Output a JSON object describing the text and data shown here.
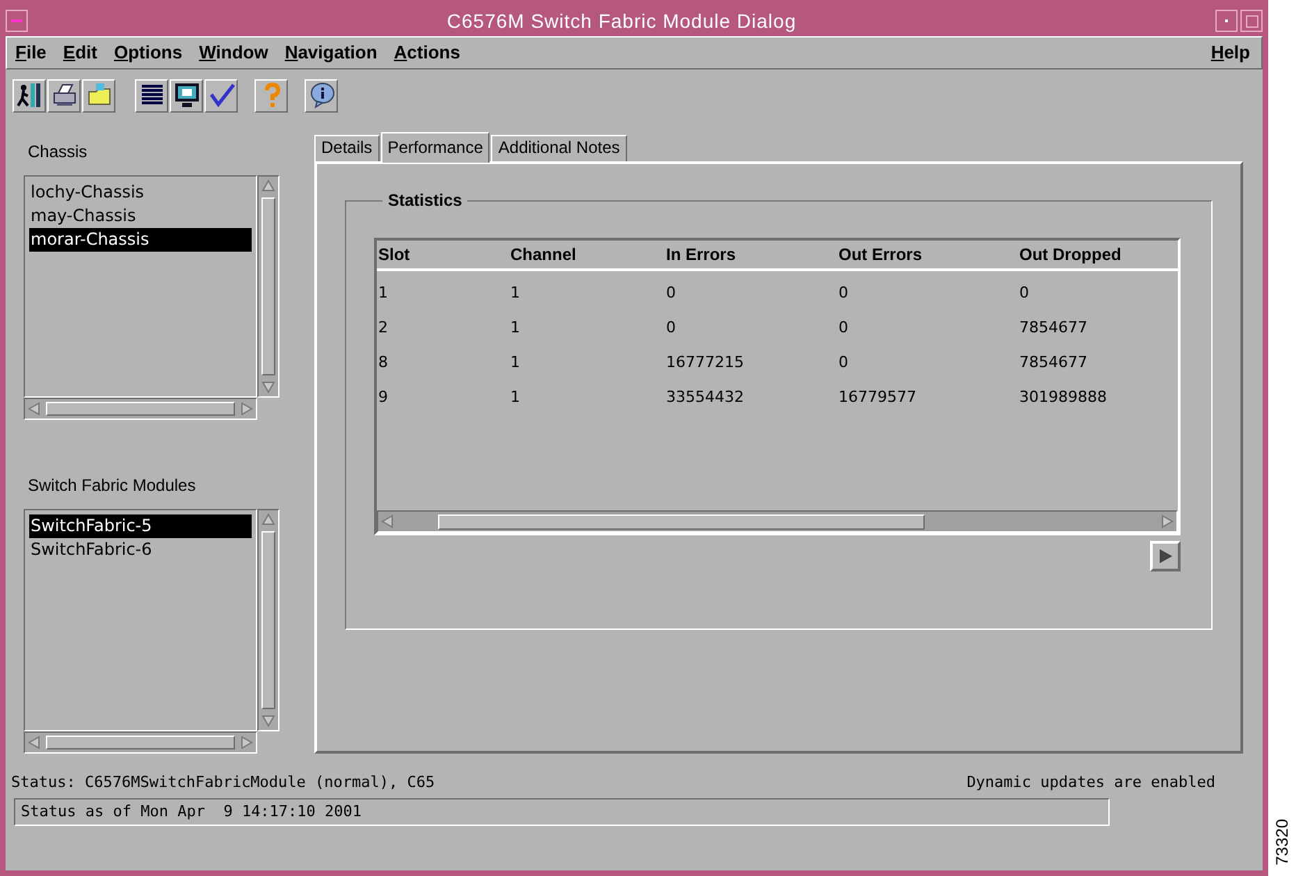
{
  "window": {
    "title": "C6576M Switch Fabric Module Dialog"
  },
  "menu": [
    {
      "label": "File"
    },
    {
      "label": "Edit"
    },
    {
      "label": "Options"
    },
    {
      "label": "Window"
    },
    {
      "label": "Navigation"
    },
    {
      "label": "Actions"
    }
  ],
  "help_menu": {
    "label": "Help"
  },
  "chassis": {
    "label": "Chassis",
    "items": [
      {
        "label": "lochy-Chassis",
        "selected": false
      },
      {
        "label": "may-Chassis",
        "selected": false
      },
      {
        "label": "morar-Chassis",
        "selected": true
      }
    ]
  },
  "modules": {
    "label": "Switch Fabric Modules",
    "items": [
      {
        "label": "SwitchFabric-5",
        "selected": true
      },
      {
        "label": "SwitchFabric-6",
        "selected": false
      }
    ]
  },
  "tabs": [
    {
      "label": "Details",
      "selected": false
    },
    {
      "label": "Performance",
      "selected": true
    },
    {
      "label": "Additional Notes",
      "selected": false
    }
  ],
  "statistics": {
    "title": "Statistics",
    "columns": [
      "Slot",
      "Channel",
      "In Errors",
      "Out Errors",
      "Out Dropped"
    ],
    "rows": [
      [
        "1",
        "1",
        "0",
        "0",
        "0"
      ],
      [
        "2",
        "1",
        "0",
        "0",
        "7854677"
      ],
      [
        "8",
        "1",
        "16777215",
        "0",
        "7854677"
      ],
      [
        "9",
        "1",
        "33554432",
        "16779577",
        "301989888"
      ]
    ]
  },
  "status_bar": {
    "status": "Status: C6576MSwitchFabricModule (normal), C65",
    "updates": "Dynamic updates are enabled",
    "status_as_of": "Status as of Mon Apr  9 14:17:10 2001"
  },
  "figure_number": "73320"
}
